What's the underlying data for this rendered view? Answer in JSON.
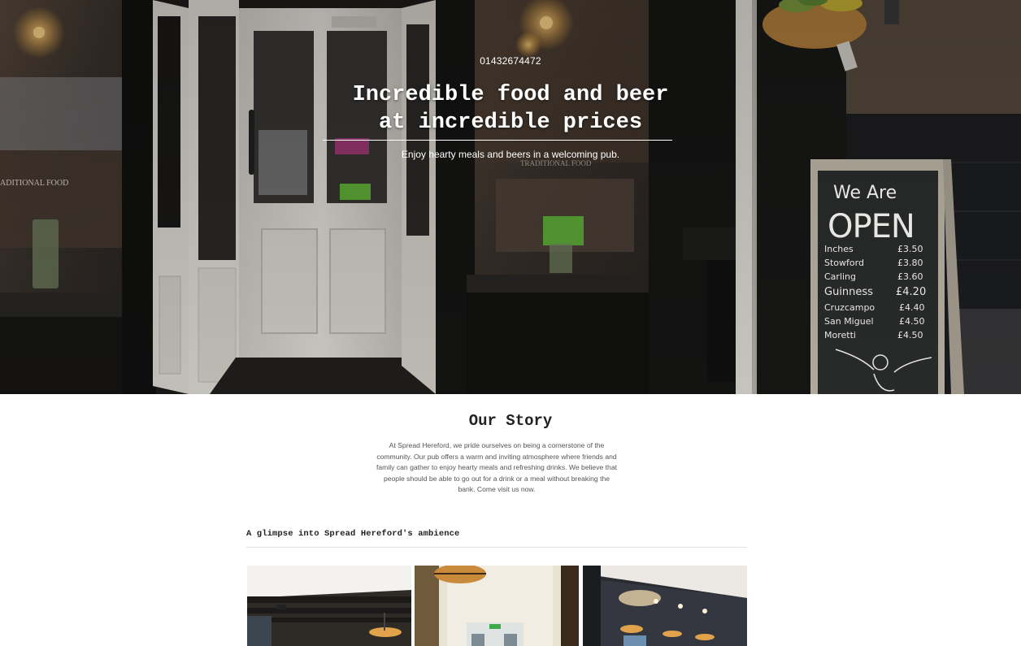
{
  "hero": {
    "phone": "01432674472",
    "title_line1": "Incredible food and beer",
    "title_line2": "at incredible prices",
    "subtitle": "Enjoy hearty meals and beers in a welcoming pub.",
    "window_text_left": "ADITIONAL FOOD",
    "window_text_right": "TRADITIONAL FOOD",
    "chalkboard": {
      "heading1": "We Are",
      "heading2": "OPEN",
      "items": [
        {
          "name": "Inches",
          "price": "£3.50"
        },
        {
          "name": "Stowford",
          "price": "£3.80"
        },
        {
          "name": "Carling",
          "price": "£3.60"
        },
        {
          "name": "Guinness",
          "price": "£4.20"
        },
        {
          "name": "Cruzcampo",
          "price": "£4.40"
        },
        {
          "name": "San Miguel",
          "price": "£4.50"
        },
        {
          "name": "Moretti",
          "price": "£4.50"
        }
      ]
    }
  },
  "story": {
    "title": "Our Story",
    "body": "At Spread Hereford, we pride ourselves on being a cornerstone of the community. Our pub offers a warm and inviting atmosphere where friends and family can gather to enjoy hearty meals and refreshing drinks. We believe that people should be able to go out for a drink or a meal without breaking the bank. Come visit us now."
  },
  "gallery": {
    "heading": "A glimpse into Spread Hereford's ambience"
  },
  "colors": {
    "shopfront_black": "#1d1c1a",
    "door_white": "#e9e6e0",
    "chalkboard": "#2f3131",
    "frame_wood": "#cfc6b6",
    "text_dark": "#222222",
    "text_body": "#555555"
  }
}
